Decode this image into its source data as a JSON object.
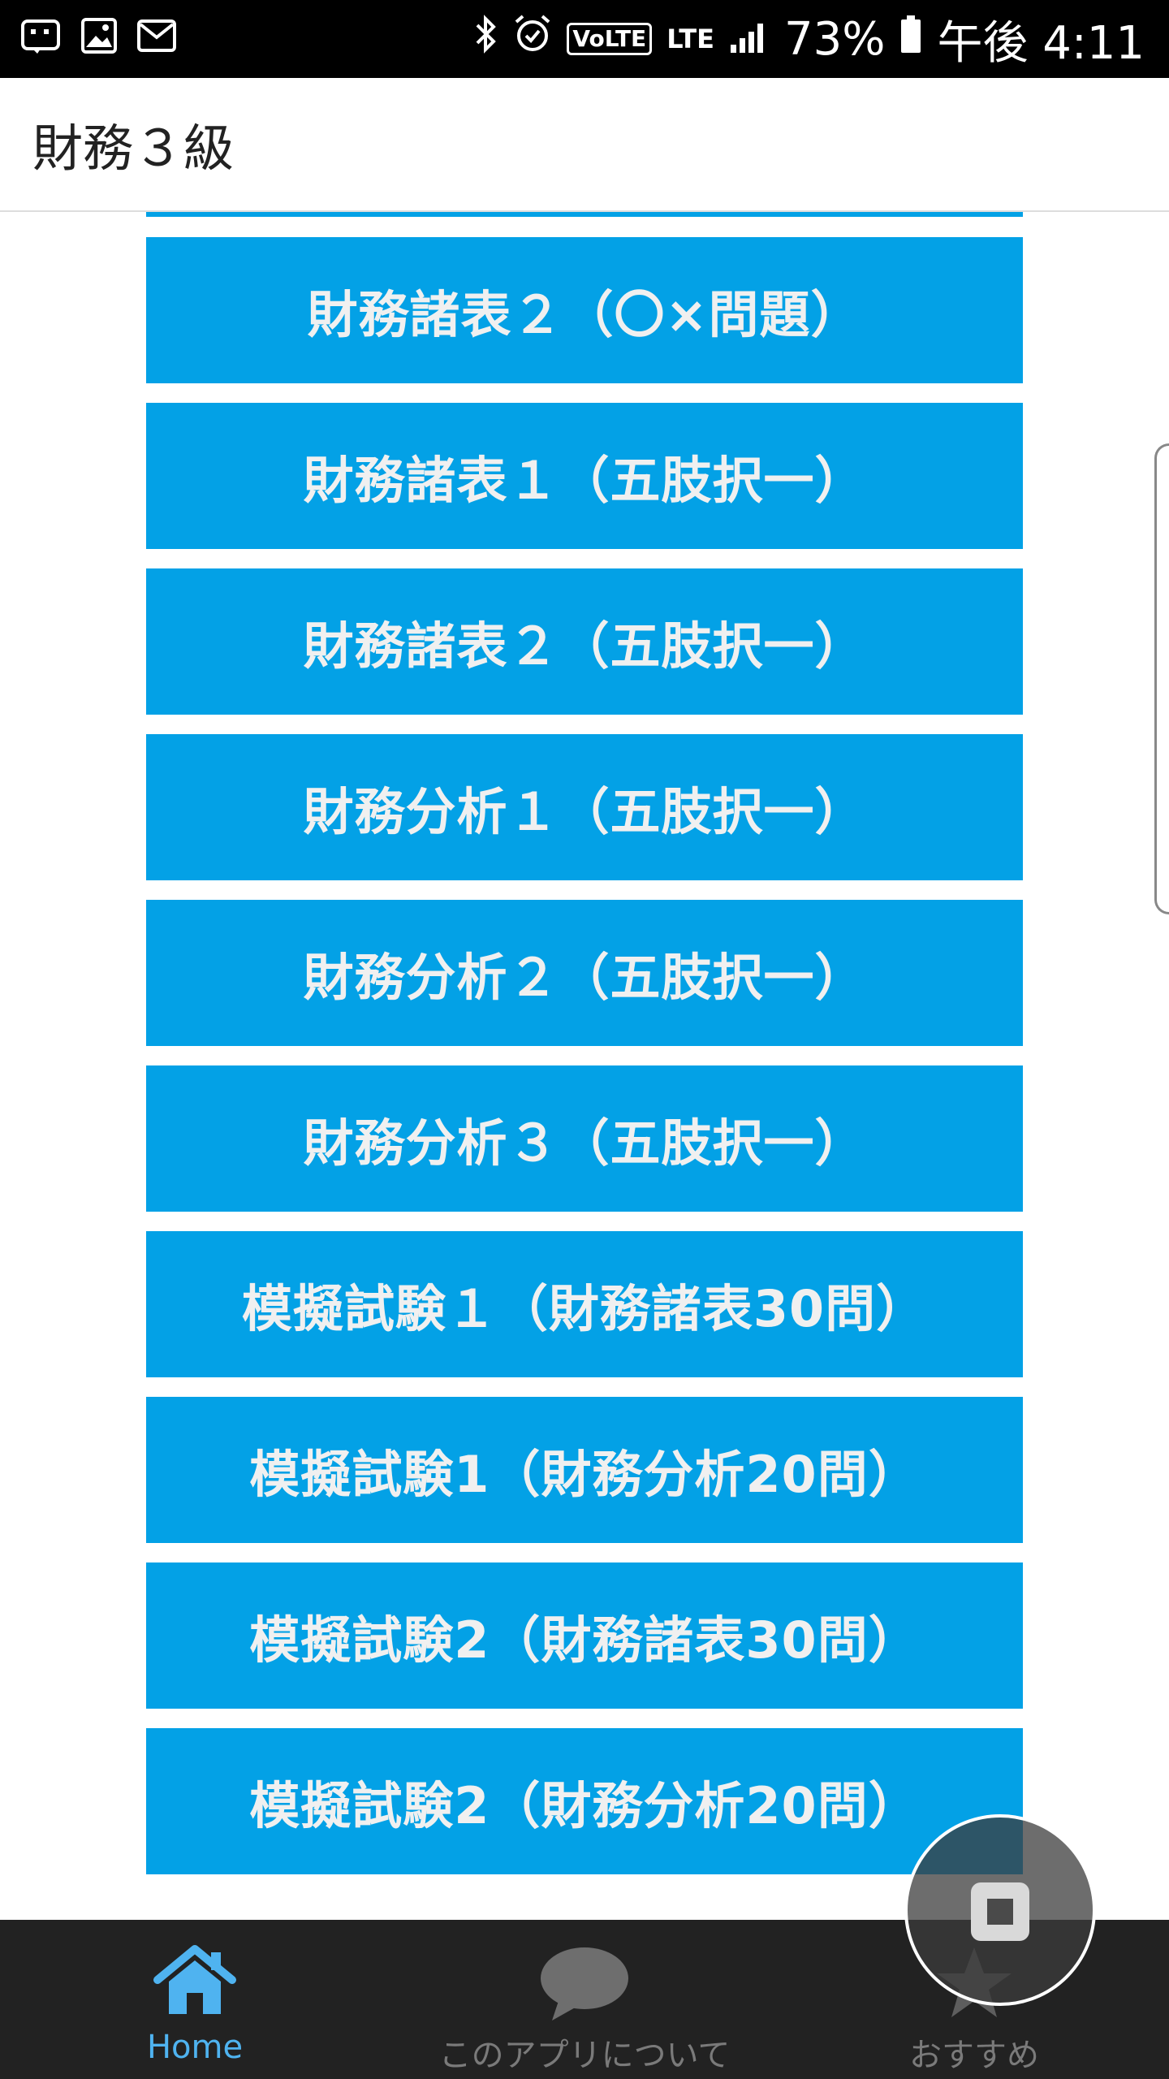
{
  "status_bar": {
    "battery_percent": "73%",
    "time": "午後 4:11",
    "network": "LTE",
    "volte": "VoLTE",
    "left_icons": [
      "notification-icon",
      "gallery-icon",
      "mail-icon"
    ],
    "right_icons": [
      "bluetooth-icon",
      "alarm-icon",
      "signal-icon",
      "battery-icon"
    ]
  },
  "app_bar": {
    "title": "財務３級"
  },
  "menu": {
    "items": [
      {
        "label": "財務諸表２（〇×問題）"
      },
      {
        "label": "財務諸表１（五肢択一）"
      },
      {
        "label": "財務諸表２（五肢択一）"
      },
      {
        "label": "財務分析１（五肢択一）"
      },
      {
        "label": "財務分析２（五肢択一）"
      },
      {
        "label": "財務分析３（五肢択一）"
      },
      {
        "label": "模擬試験１（財務諸表30問）"
      },
      {
        "label": "模擬試験1（財務分析20問）"
      },
      {
        "label": "模擬試験2（財務諸表30問）"
      },
      {
        "label": "模擬試験2（財務分析20問）"
      }
    ]
  },
  "bottom_nav": {
    "items": [
      {
        "label": "Home",
        "icon": "home-icon",
        "active": true
      },
      {
        "label": "このアプリについて",
        "icon": "speech-bubble-icon",
        "active": false
      },
      {
        "label": "おすすめ",
        "icon": "star-icon",
        "active": false
      }
    ]
  },
  "colors": {
    "button_bg": "#03a1e6",
    "button_text": "#f0f0f0",
    "nav_bg": "#222222",
    "nav_active": "#4fb3f0",
    "nav_inactive": "#7a7a7a"
  }
}
